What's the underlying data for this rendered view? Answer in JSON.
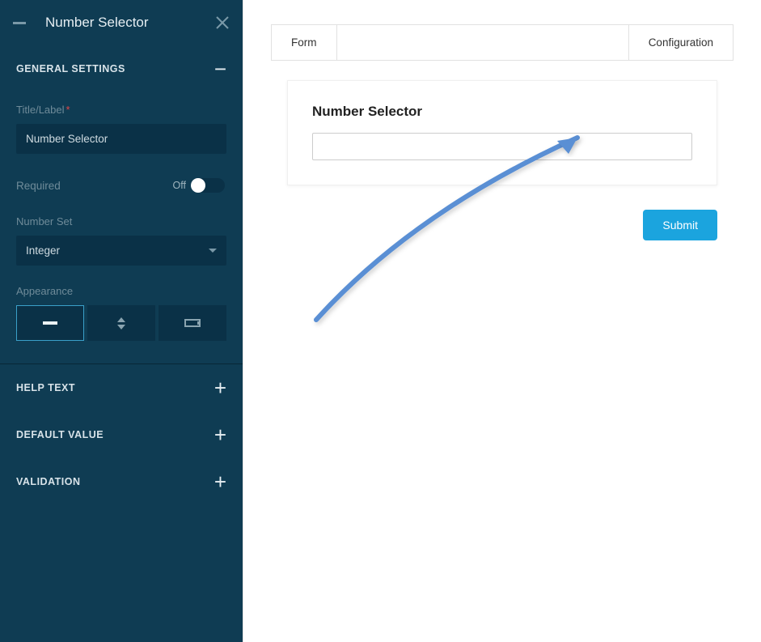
{
  "sidebar": {
    "title": "Number Selector",
    "sections": {
      "general": {
        "title": "GENERAL SETTINGS",
        "expanded": true,
        "fields": {
          "title_label": {
            "label": "Title/Label",
            "required": true,
            "value": "Number Selector"
          },
          "required": {
            "label": "Required",
            "state_text": "Off",
            "value": false
          },
          "number_set": {
            "label": "Number Set",
            "value": "Integer"
          },
          "appearance": {
            "label": "Appearance",
            "options": [
              "line",
              "spinner",
              "slider"
            ],
            "selected_index": 0
          }
        }
      },
      "help_text": {
        "title": "HELP TEXT",
        "expanded": false
      },
      "default_value": {
        "title": "DEFAULT VALUE",
        "expanded": false
      },
      "validation": {
        "title": "VALIDATION",
        "expanded": false
      }
    }
  },
  "preview": {
    "tabs": {
      "form": "Form",
      "configuration": "Configuration"
    },
    "widget_title": "Number Selector",
    "submit_label": "Submit"
  }
}
